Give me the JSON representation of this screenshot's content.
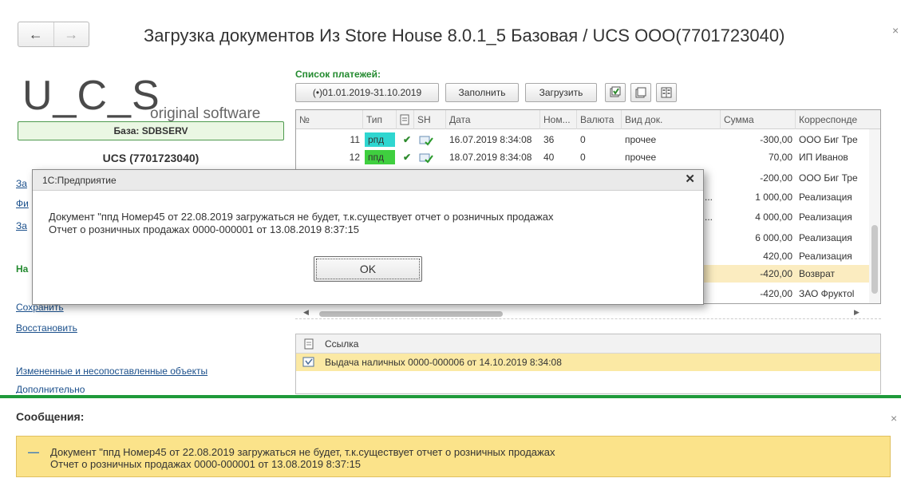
{
  "window": {
    "title": "Загрузка документов Из Store House 8.0.1_5 Базовая   / UCS ООО(7701723040)",
    "back_glyph": "←",
    "forward_glyph": "→",
    "close_glyph": "×"
  },
  "sidebar": {
    "logo_main": "U_C_S",
    "logo_sub": "original software",
    "base_label": "База: SDBSERV",
    "org_name": "UCS (7701723040)",
    "partial_items": [
      "За",
      "Фи",
      "За",
      "",
      "На",
      ""
    ],
    "links": [
      "Сохранить",
      "Восстановить",
      "Измененные и несопоставленные объекты",
      "Дополнительно"
    ]
  },
  "payments": {
    "title": "Список платежей:",
    "period": "(•)01.01.2019-31.10.2019",
    "fill_label": "Заполнить",
    "load_label": "Загрузить",
    "columns": [
      "№",
      "Тип",
      "",
      "SH",
      "Дата",
      "Ном...",
      "Валюта",
      "Вид док.",
      "Сумма",
      "Корреспонде"
    ],
    "rows": [
      {
        "num": "11",
        "type": "рпд",
        "check": "✔",
        "date": "16.07.2019 8:34:08",
        "nomer": "36",
        "currency": "0",
        "kind": "прочее",
        "sum": "-300,00",
        "corr": "ООО Биг Тре"
      },
      {
        "num": "12",
        "type": "ппд",
        "check": "✔",
        "date": "18.07.2019 8:34:08",
        "nomer": "40",
        "currency": "0",
        "kind": "прочее",
        "sum": "70,00",
        "corr": "ИП Иванов"
      },
      {
        "num": "",
        "type": "",
        "check": "",
        "date": "",
        "nomer": "",
        "currency": "",
        "kind": "",
        "sum": "-200,00",
        "corr": "ООО Биг Тре"
      },
      {
        "num": "",
        "type": "",
        "check": "",
        "date": "",
        "nomer": "",
        "currency": "",
        "kind": "...",
        "sum": "1 000,00",
        "corr": "Реализация"
      },
      {
        "num": "",
        "type": "",
        "check": "",
        "date": "",
        "nomer": "",
        "currency": "",
        "kind": "...",
        "sum": "4 000,00",
        "corr": "Реализация"
      },
      {
        "num": "",
        "type": "",
        "check": "",
        "date": "",
        "nomer": "",
        "currency": "",
        "kind": "",
        "sum": "6 000,00",
        "corr": "Реализация"
      },
      {
        "num": "",
        "type": "",
        "check": "",
        "date": "",
        "nomer": "",
        "currency": "",
        "kind": "",
        "sum": "420,00",
        "corr": "Реализация"
      },
      {
        "num": "",
        "type": "",
        "check": "",
        "date": "",
        "nomer": "",
        "currency": "",
        "kind": "",
        "sum": "-420,00",
        "corr": "Возврат"
      },
      {
        "num": "",
        "type": "",
        "check": "",
        "date": "",
        "nomer": "",
        "currency": "",
        "kind": "",
        "sum": "-420,00",
        "corr": "ЗАО Фруктоl"
      }
    ]
  },
  "reference": {
    "header": "Ссылка",
    "row": "Выдача наличных 0000-000006 от 14.10.2019 8:34:08"
  },
  "messages": {
    "title": "Сообщения:",
    "line1": "Документ \"ппд Номер45 от 22.08.2019 загружаться не будет, т.к.существует отчет о розничных продажах",
    "line2": "Отчет о розничных продажах 0000-000001 от 13.08.2019 8:37:15",
    "dash": "—"
  },
  "dialog": {
    "title": "1С:Предприятие",
    "line1": "Документ \"ппд Номер45 от 22.08.2019 загружаться не будет, т.к.существует отчет о розничных продажах",
    "line2": "Отчет о розничных продажах 0000-000001 от 13.08.2019 8:37:15",
    "ok_label": "OK",
    "close_glyph": "✕"
  },
  "colors": {
    "accent_green": "#238a2f",
    "type_cyan": "#2fd6d0",
    "type_green": "#3fcf3f",
    "message_bg": "#fbe38a"
  }
}
